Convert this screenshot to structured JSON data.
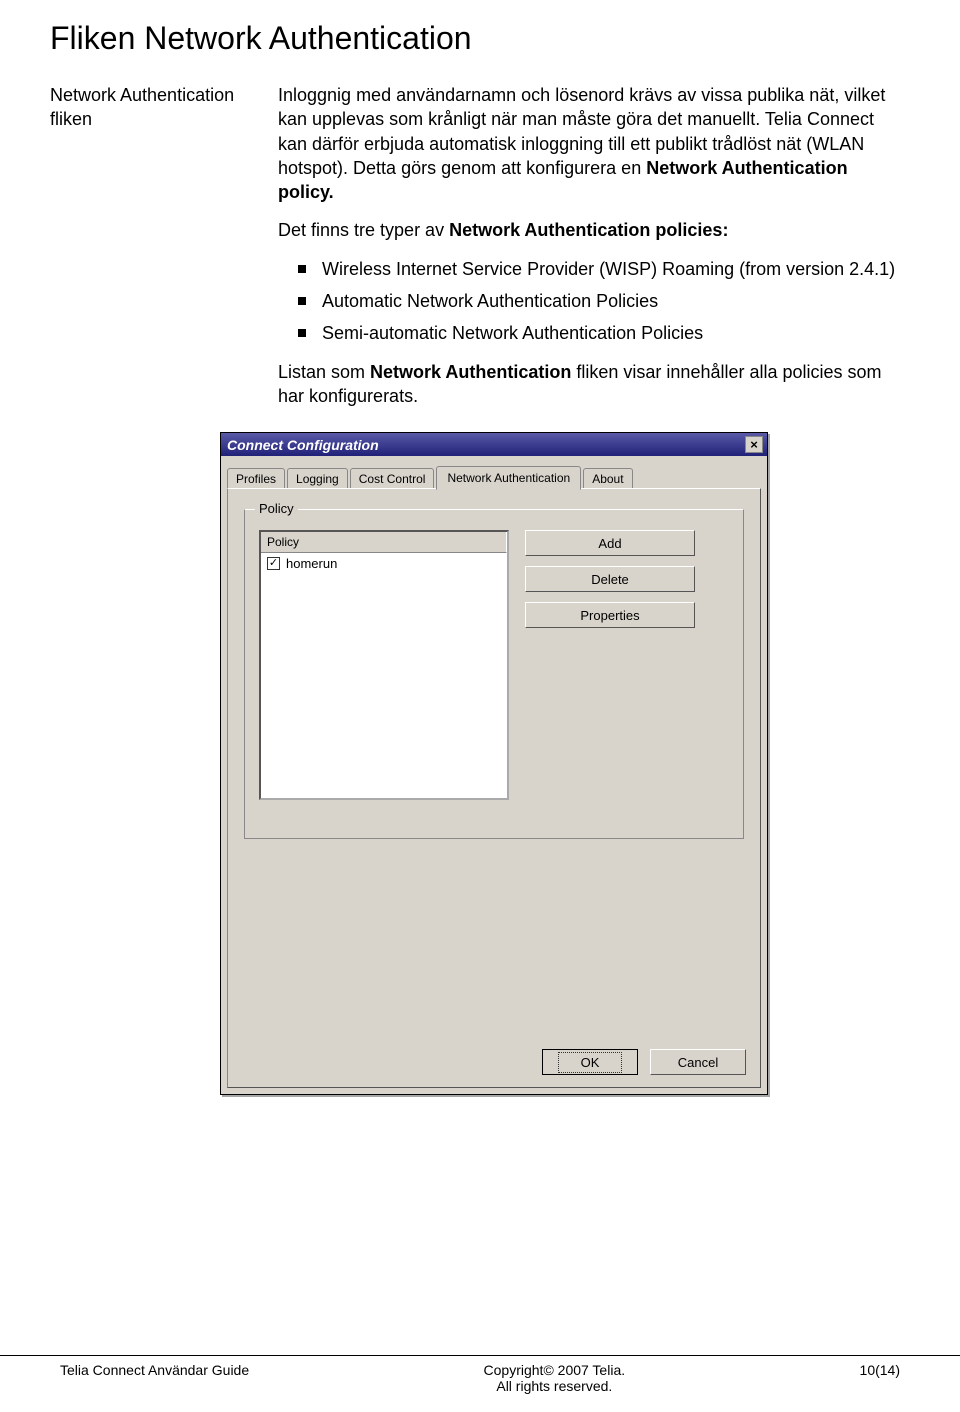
{
  "h1": "Fliken Network Authentication",
  "side_label": "Network Authentication fliken",
  "para1": {
    "a": "Inloggnig med användarnamn och lösenord krävs av vissa publika nät, vilket kan upplevas som krånligt när man måste göra det manuellt. Telia Connect kan därför erbjuda automatisk inloggning till ett publikt trådlöst nät (WLAN hotspot). Detta görs genom att konfigurera en ",
    "b": "Network Authentication policy."
  },
  "para2": {
    "a": "Det finns tre typer av ",
    "b": "Network Authentication policies:"
  },
  "policies": [
    "Wireless Internet Service Provider (WISP) Roaming (from version 2.4.1)",
    "Automatic Network Authentication Policies",
    "Semi-automatic Network Authentication Policies"
  ],
  "para3": {
    "a": "Listan som ",
    "b": "Network Authentication",
    "c": " fliken visar innehåller alla policies som har konfigurerats."
  },
  "dialog": {
    "title": "Connect Configuration",
    "close": "×",
    "tabs": [
      "Profiles",
      "Logging",
      "Cost Control",
      "Network Authentication",
      "About"
    ],
    "active_tab": "Network Authentication",
    "group_label": "Policy",
    "list_header": "Policy",
    "list_items": [
      {
        "checked": true,
        "label": "homerun"
      }
    ],
    "buttons": {
      "add": "Add",
      "delete": "Delete",
      "properties": "Properties"
    },
    "ok": "OK",
    "cancel": "Cancel"
  },
  "footer": {
    "left": "Telia Connect Användar Guide",
    "center1": "Copyright© 2007 Telia.",
    "center2": "All rights reserved.",
    "right": "10(14)"
  }
}
